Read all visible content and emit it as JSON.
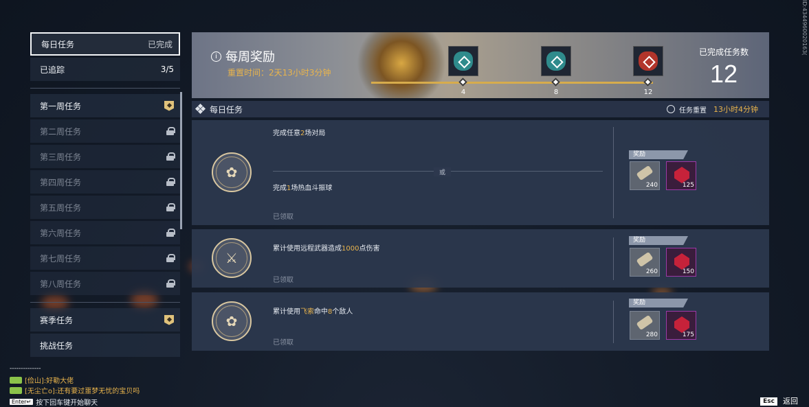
{
  "nav": {
    "daily": {
      "label": "每日任务",
      "status": "已完成"
    },
    "tracked": {
      "label": "已追踪",
      "count": "3/5"
    },
    "weeks": [
      {
        "label": "第一周任务",
        "locked": false
      },
      {
        "label": "第二周任务",
        "locked": true
      },
      {
        "label": "第三周任务",
        "locked": true
      },
      {
        "label": "第四周任务",
        "locked": true
      },
      {
        "label": "第五周任务",
        "locked": true
      },
      {
        "label": "第六周任务",
        "locked": true
      },
      {
        "label": "第七周任务",
        "locked": true
      },
      {
        "label": "第八周任务",
        "locked": true
      }
    ],
    "season": {
      "label": "赛季任务"
    },
    "challenge": {
      "label": "挑战任务"
    }
  },
  "banner": {
    "title": "每周奖励",
    "reset": "重置时间：2天13小时3分钟",
    "milestones": [
      "4",
      "8",
      "12"
    ],
    "completed_label": "已完成任务数",
    "completed_count": "12"
  },
  "daily_header": {
    "title": "每日任务",
    "reset_label": "任务重置",
    "reset_time": "13小时4分钟"
  },
  "tasks": [
    {
      "text_pre": "完成任意",
      "num": "2",
      "text_post": "场对局",
      "or": "或",
      "alt_pre": "完成",
      "alt_num": "1",
      "alt_post": "场热血斗振球",
      "status": "已领取",
      "reward_label": "奖励",
      "reward1": "240",
      "reward2": "125"
    },
    {
      "text_pre": "累计使用远程武器造成",
      "num": "1000",
      "text_post": "点伤害",
      "status": "已领取",
      "reward_label": "奖励",
      "reward1": "260",
      "reward2": "150"
    },
    {
      "text_pre": "累计使用",
      "num": "飞索",
      "text_mid": "命中",
      "num2": "8",
      "text_post": "个敌人",
      "status": "已领取",
      "reward_label": "奖励",
      "reward1": "280",
      "reward2": "175"
    }
  ],
  "chat": {
    "separator": "--------------",
    "line1": "[俭山]:好勒大佬",
    "line2": "[无尘亡o]:还有要过噩梦无忧的宝贝吗",
    "enter_key": "Enter↵",
    "enter_hint": "按下回车键开始聊天"
  },
  "esc": {
    "key": "Esc",
    "label": "返回"
  },
  "watermark": "ID:4344960020163("
}
